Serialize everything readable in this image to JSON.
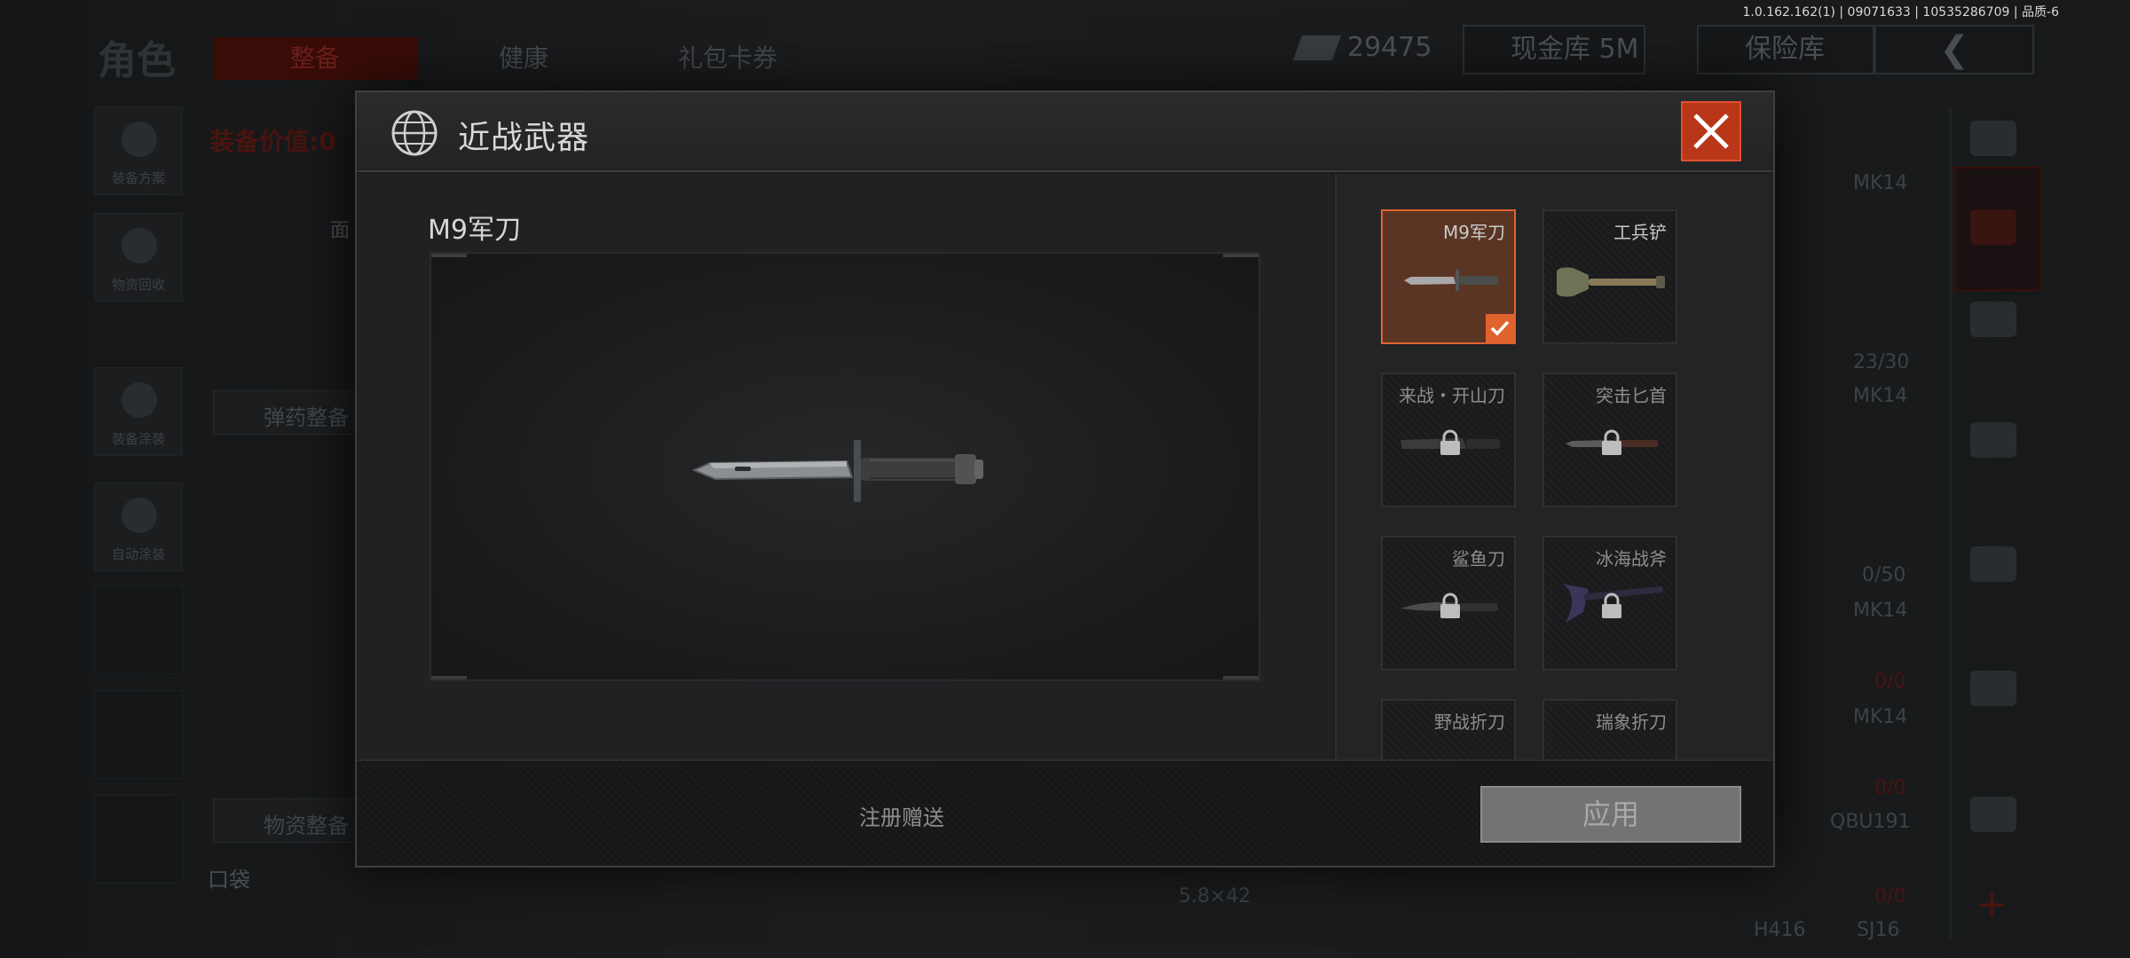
{
  "version_info": "1.0.162.162(1) | 09071633 | 10535286709 | 品质-6",
  "background": {
    "role_title": "角色",
    "tabs": [
      {
        "label": "整备",
        "active": true
      },
      {
        "label": "健康",
        "active": false
      },
      {
        "label": "礼包卡券",
        "active": false
      }
    ],
    "currency_value": "29475",
    "cash_vault": "现金库 5M",
    "safe_box": "保险库",
    "equipment_value": "装备价值:0",
    "left_buttons": [
      "装备方案",
      "物资回收",
      "装备涂装",
      "自动涂装"
    ],
    "ammo_label": "弹药整备",
    "supplies_label": "物资整备",
    "pocket_label": "口袋",
    "slot_label_partial": "面",
    "weapon_list": [
      "MK14",
      "MK14",
      "MK14",
      "MK14",
      "QBU191"
    ],
    "ammo_counts": [
      "23/30",
      "0/50",
      "0/0",
      "0/0",
      "0/0"
    ],
    "caliber": "5.8×42",
    "bottom_tags": [
      "H416",
      "SJ16"
    ]
  },
  "modal": {
    "title": "近战武器",
    "selected_weapon_name": "M9军刀",
    "weapons": [
      {
        "label": "M9军刀",
        "selected": true,
        "locked": false,
        "icon": "bayonet-icon"
      },
      {
        "label": "工兵铲",
        "selected": false,
        "locked": false,
        "icon": "shovel-icon"
      },
      {
        "label": "来战・开山刀",
        "selected": false,
        "locked": true,
        "icon": "machete-icon"
      },
      {
        "label": "突击匕首",
        "selected": false,
        "locked": true,
        "icon": "dagger-icon"
      },
      {
        "label": "鲨鱼刀",
        "selected": false,
        "locked": true,
        "icon": "shark-knife-icon"
      },
      {
        "label": "冰海战斧",
        "selected": false,
        "locked": true,
        "icon": "axe-icon"
      },
      {
        "label": "野战折刀",
        "selected": false,
        "locked": true,
        "icon": "folding-knife-icon"
      },
      {
        "label": "瑞象折刀",
        "selected": false,
        "locked": true,
        "icon": "folding-knife-icon"
      }
    ],
    "footer_note": "注册赠送",
    "apply_label": "应用"
  },
  "colors": {
    "accent": "#e0632e",
    "close_bg": "#b93618",
    "apply_bg": "#727373"
  }
}
